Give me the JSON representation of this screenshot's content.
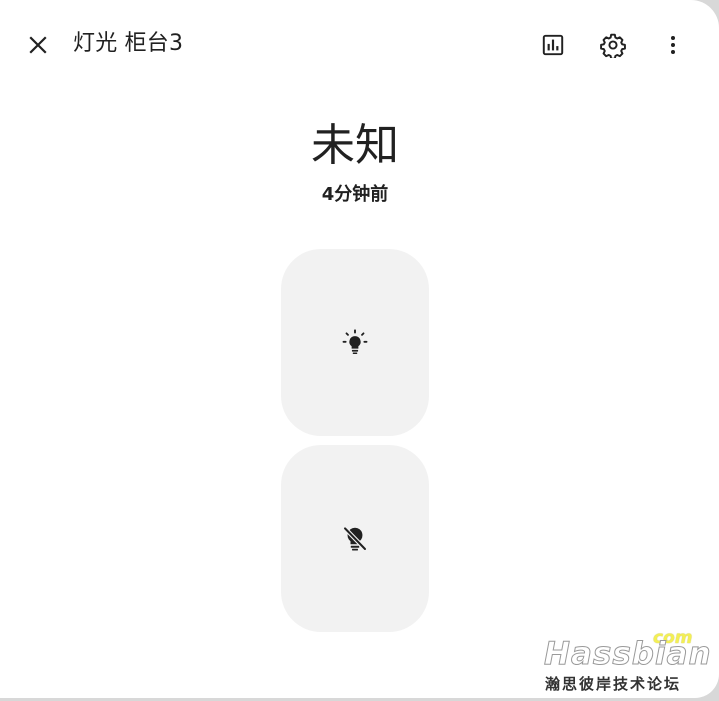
{
  "dialog": {
    "title": "灯光 柜台3",
    "state": "未知",
    "last_changed": "4分钟前"
  },
  "icons": {
    "close": "close-icon",
    "history": "chart-icon",
    "settings": "gear-icon",
    "more": "more-vertical-icon",
    "on": "lightbulb-on-icon",
    "off": "lightbulb-off-icon"
  },
  "watermark": {
    "com": "com",
    "name": "Hassbian",
    "subtitle": "瀚思彼岸技术论坛"
  },
  "colors": {
    "background": "#ffffff",
    "control_bg": "#f2f2f2",
    "text": "#212121"
  }
}
